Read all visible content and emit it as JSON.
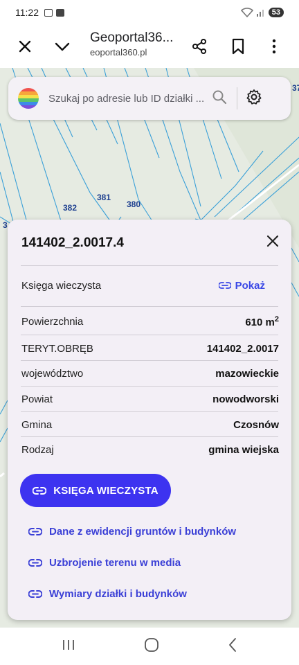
{
  "status": {
    "time": "11:22",
    "battery": "53"
  },
  "appbar": {
    "title": "Geoportal36...",
    "subtitle": "eoportal360.pl"
  },
  "search": {
    "placeholder": "Szukaj po adresie lub ID działki ..."
  },
  "map": {
    "plot_labels": [
      "382",
      "381",
      "380",
      "3",
      "37"
    ]
  },
  "card": {
    "parcel_id": "141402_2.0017.4",
    "book_label": "Księga wieczysta",
    "book_link": "Pokaż",
    "rows": [
      {
        "label": "Powierzchnia",
        "value": "610 m",
        "sup": "2"
      },
      {
        "label": "TERYT.OBRĘB",
        "value": "141402_2.0017"
      },
      {
        "label": "województwo",
        "value": "mazowieckie"
      },
      {
        "label": "Powiat",
        "value": "nowodworski"
      },
      {
        "label": "Gmina",
        "value": "Czosnów"
      },
      {
        "label": "Rodzaj",
        "value": "gmina wiejska"
      }
    ],
    "main_button": "KSIĘGA WIECZYSTA",
    "links": [
      "Dane z ewidencji gruntów i budynków",
      "Uzbrojenie terenu w media",
      "Wymiary działki i budynków"
    ]
  },
  "colors": {
    "accent": "#3d33f0",
    "link": "#3a3fd6",
    "card_bg": "#f3eff6",
    "parcel_line": "#3aa0d8"
  }
}
